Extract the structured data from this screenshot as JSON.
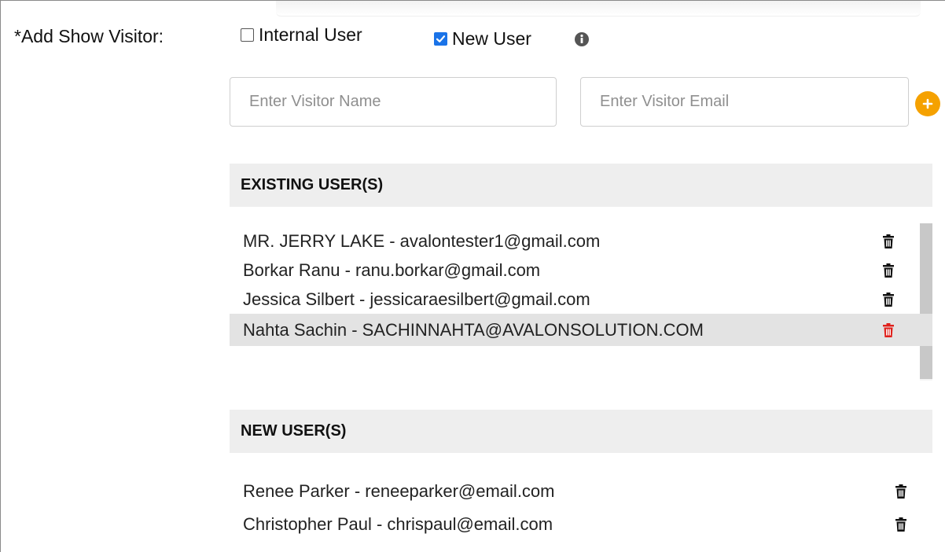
{
  "form": {
    "field_label": "*Add Show Visitor:",
    "options": {
      "internal_user": {
        "label": "Internal User",
        "checked": false
      },
      "new_user": {
        "label": "New User",
        "checked": true
      }
    },
    "info_icon": "info-circle-icon",
    "inputs": {
      "name_placeholder": "Enter Visitor Name",
      "email_placeholder": "Enter Visitor Email",
      "name_value": "",
      "email_value": ""
    },
    "add_icon": "plus-circle-icon"
  },
  "existing_users": {
    "header": "EXISTING USER(S)",
    "rows": [
      {
        "text": "MR. JERRY LAKE - avalontester1@gmail.com",
        "highlighted": false
      },
      {
        "text": "Borkar Ranu - ranu.borkar@gmail.com",
        "highlighted": false
      },
      {
        "text": "Jessica Silbert - jessicaraesilbert@gmail.com",
        "highlighted": false
      },
      {
        "text": "Nahta Sachin - SACHINNAHTA@AVALONSOLUTION.COM",
        "highlighted": true
      }
    ]
  },
  "new_users": {
    "header": "NEW USER(S)",
    "rows": [
      {
        "text": "Renee Parker - reneeparker@email.com"
      },
      {
        "text": "Christopher Paul - chrispaul@email.com"
      }
    ]
  },
  "colors": {
    "checkbox_checked": "#1a73e8",
    "add_button": "#f5a100",
    "trash_default": "#111111",
    "trash_hover": "#e0201b",
    "section_header_bg": "#eeeeee",
    "row_highlight_bg": "#e3e3e3"
  }
}
